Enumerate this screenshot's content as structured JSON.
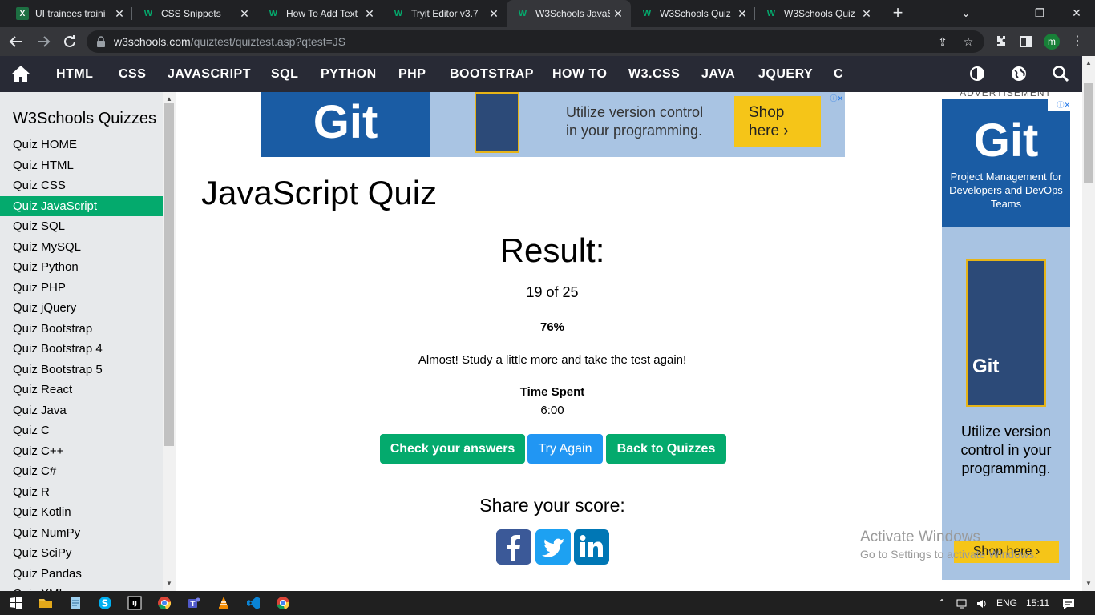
{
  "browser": {
    "tabs": [
      {
        "title": "UI trainees traini",
        "icon": "excel-icon",
        "active": false
      },
      {
        "title": "CSS Snippets",
        "icon": "w3schools-icon",
        "active": false
      },
      {
        "title": "How To Add Text",
        "icon": "w3schools-icon",
        "active": false
      },
      {
        "title": "Tryit Editor v3.7",
        "icon": "w3schools-icon",
        "active": false
      },
      {
        "title": "W3Schools JavaS",
        "icon": "w3schools-icon",
        "active": true
      },
      {
        "title": "W3Schools Quiz",
        "icon": "w3schools-icon",
        "active": false
      },
      {
        "title": "W3Schools Quiz",
        "icon": "w3schools-icon",
        "active": false
      }
    ],
    "url_domain": "w3schools.com",
    "url_path": "/quiztest/quiztest.asp?qtest=JS",
    "profile_initial": "m"
  },
  "nav": {
    "links": [
      "HTML",
      "CSS",
      "JAVASCRIPT",
      "SQL",
      "PYTHON",
      "PHP",
      "BOOTSTRAP",
      "HOW TO",
      "W3.CSS",
      "JAVA",
      "JQUERY",
      "C"
    ]
  },
  "sidebar": {
    "title": "W3Schools Quizzes",
    "items": [
      "Quiz HOME",
      "Quiz HTML",
      "Quiz CSS",
      "Quiz JavaScript",
      "Quiz SQL",
      "Quiz MySQL",
      "Quiz Python",
      "Quiz PHP",
      "Quiz jQuery",
      "Quiz Bootstrap",
      "Quiz Bootstrap 4",
      "Quiz Bootstrap 5",
      "Quiz React",
      "Quiz Java",
      "Quiz C",
      "Quiz C++",
      "Quiz C#",
      "Quiz R",
      "Quiz Kotlin",
      "Quiz NumPy",
      "Quiz SciPy",
      "Quiz Pandas",
      "Quiz XML"
    ],
    "active_index": 3
  },
  "top_ad": {
    "brand": "Git",
    "tagline_line1": "Utilize version control",
    "tagline_line2": "in your programming.",
    "shop_line1": "Shop",
    "shop_line2": "here ›"
  },
  "main": {
    "title": "JavaScript Quiz",
    "result_heading": "Result:",
    "score": "19 of 25",
    "percent": "76%",
    "feedback": "Almost! Study a little more and take the test again!",
    "time_label": "Time Spent",
    "time_value": "6:00",
    "buttons": {
      "check": "Check your answers",
      "retry": "Try Again",
      "back": "Back to Quizzes"
    },
    "share_heading": "Share your score:"
  },
  "right_ad": {
    "label": "ADVERTISEMENT",
    "brand": "Git",
    "subtitle": "Project Management for Developers and DevOps Teams",
    "book_title": "Git",
    "tagline": "Utilize version control in your programming.",
    "shop": "Shop here ›"
  },
  "watermark": {
    "line1": "Activate Windows",
    "line2": "Go to Settings to activate Windows."
  },
  "taskbar": {
    "language": "ENG",
    "time": "15:11"
  },
  "colors": {
    "w3_green": "#04aa6d",
    "w3_blue": "#2196f3",
    "nav_dark": "#282a35",
    "facebook": "#3b5998",
    "twitter": "#1da1f2",
    "linkedin": "#0077b5"
  }
}
